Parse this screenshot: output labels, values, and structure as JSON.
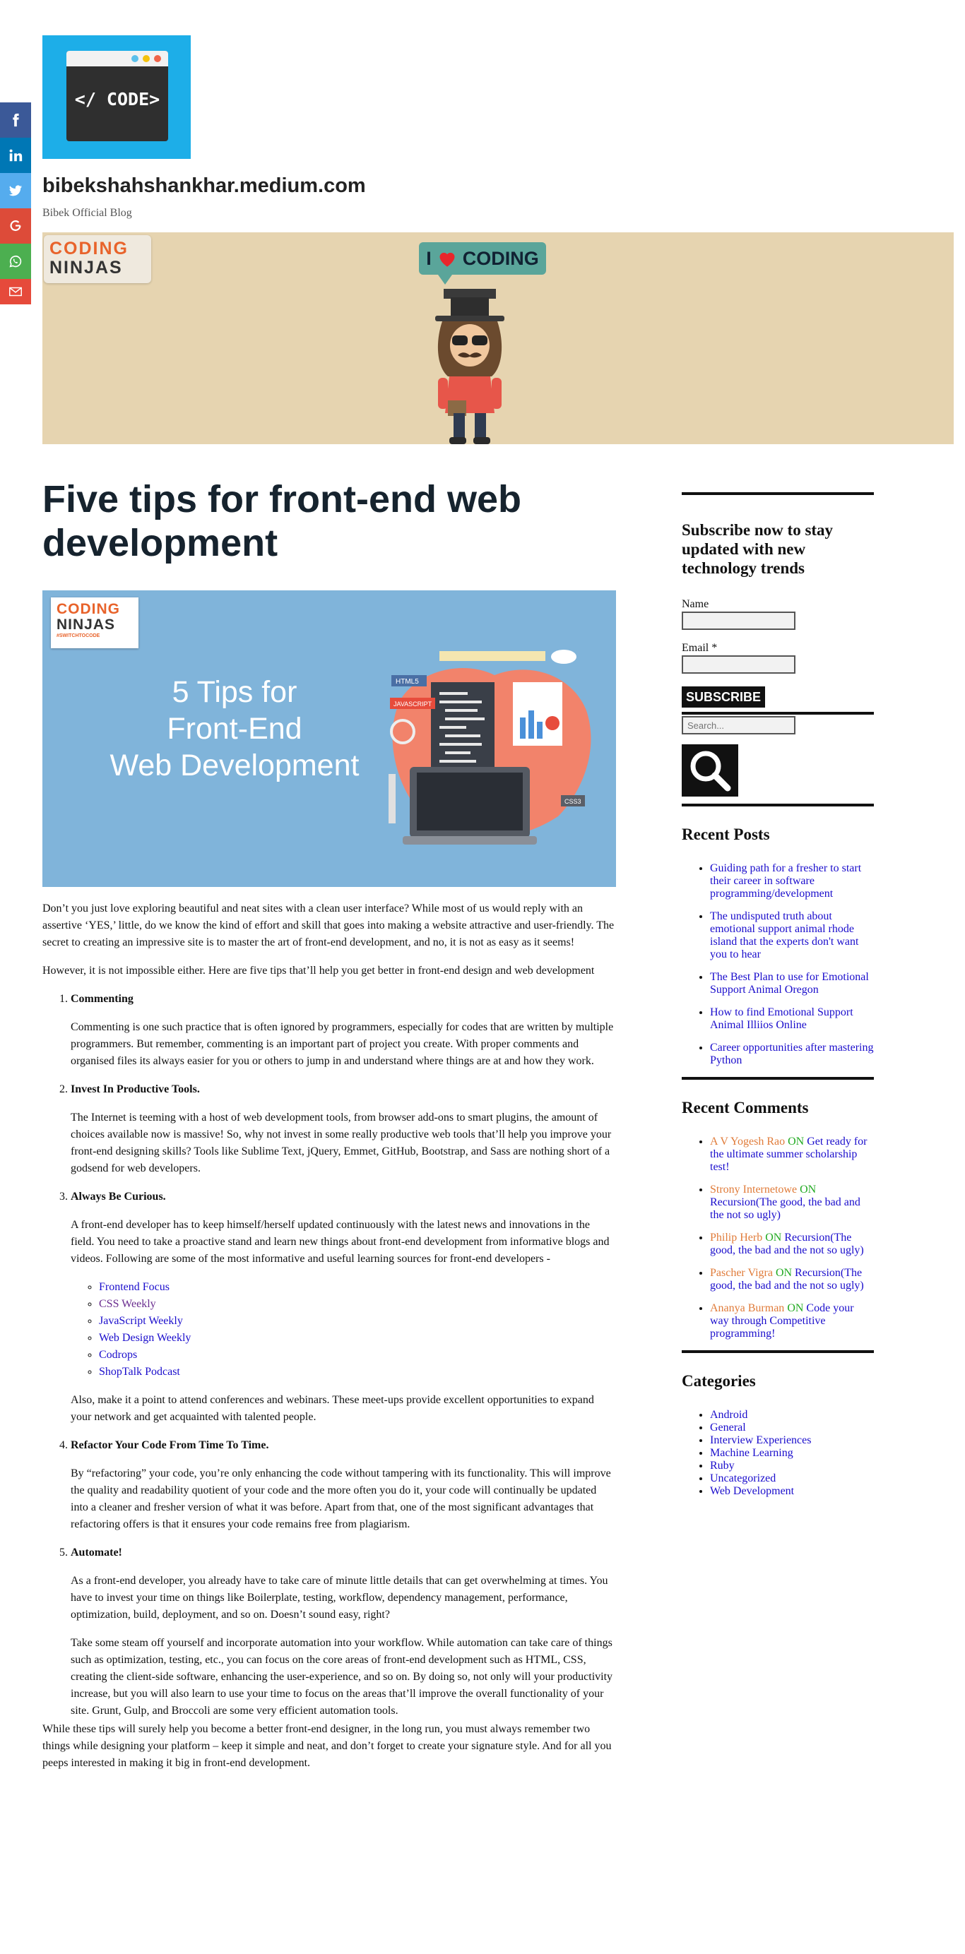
{
  "share": {
    "items": [
      {
        "name": "facebook",
        "icon": "facebook-icon",
        "color": "#3b5998"
      },
      {
        "name": "linkedin",
        "icon": "linkedin-icon",
        "color": "#0077b5"
      },
      {
        "name": "twitter",
        "icon": "twitter-icon",
        "color": "#55acee"
      },
      {
        "name": "google",
        "icon": "google-icon",
        "color": "#dd4b39"
      },
      {
        "name": "whatsapp",
        "icon": "whatsapp-icon",
        "color": "#4caf50"
      },
      {
        "name": "email",
        "icon": "email-icon",
        "color": "#e64a3b"
      }
    ]
  },
  "header": {
    "logo_text": "</ CODE>",
    "site_title": "bibekshahshankhar.medium.com",
    "tagline": "Bibek Official Blog"
  },
  "banner": {
    "logo_line1": "CODING",
    "logo_line2": "NINJAS",
    "love_text_pre": "I",
    "love_text_post": "CODING"
  },
  "post": {
    "title": "Five tips for front-end web development",
    "featured": {
      "badge_line1": "CODING",
      "badge_line2": "NINJAS",
      "badge_tag": "#SWITCHTOCODE",
      "headline_line1": "5 Tips for",
      "headline_line2": "Front-End",
      "headline_line3": "Web Development",
      "tag_html5": "HTML5",
      "tag_js": "JAVASCRIPT",
      "tag_css3": "CSS3"
    },
    "intro1": "Don’t you just love exploring beautiful and neat sites with a clean user interface? While most of us would reply with an assertive ‘YES,’ little, do we know the kind of effort and skill that goes into making a website attractive and user-friendly. The secret to creating an impressive site is to master the art of front-end development, and no, it is not as easy as it seems!",
    "intro2": "However, it is not impossible either. Here are five tips that’ll help you get better in front-end design and web development",
    "tips": [
      {
        "heading": "Commenting",
        "paragraphs": [
          "Commenting is one such practice that is often ignored by programmers, especially for codes that are written by multiple programmers. But remember, commenting is an important part of project you create. With proper comments and organised files its always easier for you or others to jump in and understand where things are at and how they work."
        ]
      },
      {
        "heading": "Invest In Productive Tools.",
        "paragraphs": [
          "The Internet is teeming with a host of web development tools, from browser add-ons to smart plugins, the amount of choices available now is massive! So, why not invest in some really productive web tools that’ll help you improve your front-end designing skills? Tools like Sublime Text, jQuery, Emmet, GitHub, Bootstrap, and Sass are nothing short of a godsend for web developers."
        ]
      },
      {
        "heading": "Always Be Curious.",
        "paragraphs": [
          "A front-end developer has to keep himself/herself updated continuously with the latest news and innovations in the field. You need to take a proactive stand and learn new things about front-end development from informative blogs and videos. Following are some of the most informative and useful learning sources for front-end developers -"
        ],
        "links": [
          "Frontend Focus",
          "CSS Weekly",
          "JavaScript Weekly",
          "Web Design Weekly",
          "Codrops",
          "ShopTalk Podcast"
        ],
        "after": "Also, make it a point to attend conferences and webinars. These meet-ups provide excellent opportunities to expand your network and get acquainted with talented people."
      },
      {
        "heading": "Refactor Your Code From Time To Time.",
        "paragraphs": [
          "By “refactoring” your code, you’re only enhancing the code without tampering with its functionality. This will improve the quality and readability quotient of your code and the more often you do it, your code will continually be updated into a cleaner and fresher version of what it was before. Apart from that, one of the most significant advantages that refactoring offers is that it ensures your code remains free from plagiarism."
        ]
      },
      {
        "heading": "Automate!",
        "paragraphs": [
          "As a front-end developer, you already have to take care of minute little details that can get overwhelming at times. You have to invest your time on things like Boilerplate, testing, workflow, dependency management, performance, optimization, build, deployment, and so on. Doesn’t sound easy, right?",
          "Take some steam off yourself and incorporate automation into your workflow. While automation can take care of things such as optimization, testing, etc., you can focus on the core areas of front-end development such as HTML, CSS, creating the client-side software, enhancing the user-experience, and so on. By doing so, not only will your productivity increase, but you will also learn to use your time to focus on the areas that’ll improve the overall functionality of your site. Grunt, Gulp, and Broccoli are some very efficient automation tools."
        ]
      }
    ],
    "closing": "While these tips will surely help you become a better front-end designer, in the long run, you must always remember two things while designing your platform – keep it simple and neat, and don’t forget to create your signature style. And for all you peeps interested in making it big in front-end development."
  },
  "sidebar": {
    "subscribe": {
      "heading": "Subscribe now to stay updated with new technology trends",
      "name_label": "Name",
      "email_label": "Email *",
      "button": "SUBSCRIBE"
    },
    "search": {
      "placeholder": "Search..."
    },
    "recent_posts": {
      "heading": "Recent Posts",
      "items": [
        "Guiding path for a fresher to start their career in software programming/development",
        "The undisputed truth about emotional support animal rhode island that the experts don't want you to hear",
        "The Best Plan to use for Emotional Support Animal Oregon",
        "How to find Emotional Support Animal Illiios Online",
        "Career opportunities after mastering Python"
      ]
    },
    "recent_comments": {
      "heading": "Recent Comments",
      "on_word": "ON",
      "items": [
        {
          "author": "A V Yogesh Rao",
          "post": "Get ready for the ultimate summer scholarship test!"
        },
        {
          "author": "Strony Internetowe",
          "post": "Recursion(The good, the bad and the not so ugly)"
        },
        {
          "author": "Philip Herb",
          "post": "Recursion(The good, the bad and the not so ugly)"
        },
        {
          "author": "Pascher Vigra",
          "post": "Recursion(The good, the bad and the not so ugly)"
        },
        {
          "author": "Ananya Burman",
          "post": "Code your way through Competitive programming!"
        }
      ]
    },
    "categories": {
      "heading": "Categories",
      "items": [
        "Android",
        "General",
        "Interview Experiences",
        "Machine Learning",
        "Ruby",
        "Uncategorized",
        "Web Development"
      ]
    }
  }
}
